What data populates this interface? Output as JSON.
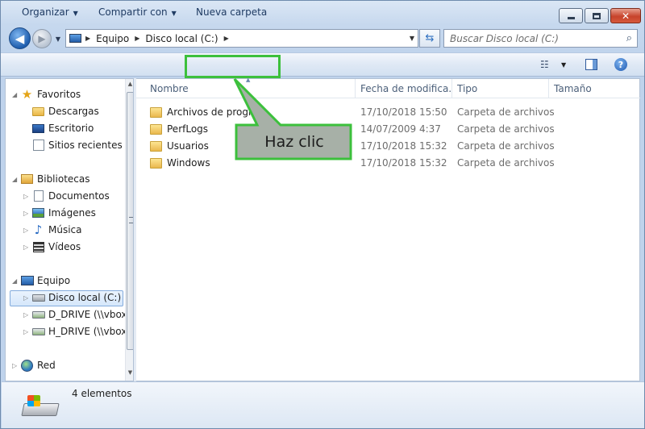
{
  "address": {
    "crumbs": [
      "Equipo",
      "Disco local (C:)"
    ]
  },
  "search": {
    "placeholder": "Buscar Disco local (C:)"
  },
  "toolbar": {
    "organizar": "Organizar",
    "compartir": "Compartir con",
    "nueva_carpeta": "Nueva carpeta"
  },
  "nav": {
    "favoritos": "Favoritos",
    "descargas": "Descargas",
    "escritorio": "Escritorio",
    "sitios": "Sitios recientes",
    "bibliotecas": "Bibliotecas",
    "documentos": "Documentos",
    "imagenes": "Imágenes",
    "musica": "Música",
    "videos": "Vídeos",
    "equipo": "Equipo",
    "disco_local": "Disco local (C:)",
    "d_drive": "D_DRIVE (\\\\vboxs",
    "h_drive": "H_DRIVE (\\\\vboxs",
    "red": "Red"
  },
  "columns": {
    "nombre": "Nombre",
    "fecha": "Fecha de modifica...",
    "tipo": "Tipo",
    "tamano": "Tamaño"
  },
  "files": [
    {
      "name": "Archivos de programa",
      "date": "17/10/2018 15:50",
      "type": "Carpeta de archivos"
    },
    {
      "name": "PerfLogs",
      "date": "14/07/2009 4:37",
      "type": "Carpeta de archivos"
    },
    {
      "name": "Usuarios",
      "date": "17/10/2018 15:32",
      "type": "Carpeta de archivos"
    },
    {
      "name": "Windows",
      "date": "17/10/2018 15:32",
      "type": "Carpeta de archivos"
    }
  ],
  "callout": {
    "text": "Haz clic"
  },
  "details": {
    "count": "4 elementos"
  },
  "colors": {
    "highlight": "#3cc03c",
    "callout_fill": "#a7b0a7"
  },
  "icons": {
    "back": "back-arrow-icon",
    "forward": "forward-arrow-icon",
    "refresh": "refresh-icon",
    "search": "search-icon",
    "help": "help-icon",
    "folder": "folder-icon",
    "star": "star-icon"
  }
}
